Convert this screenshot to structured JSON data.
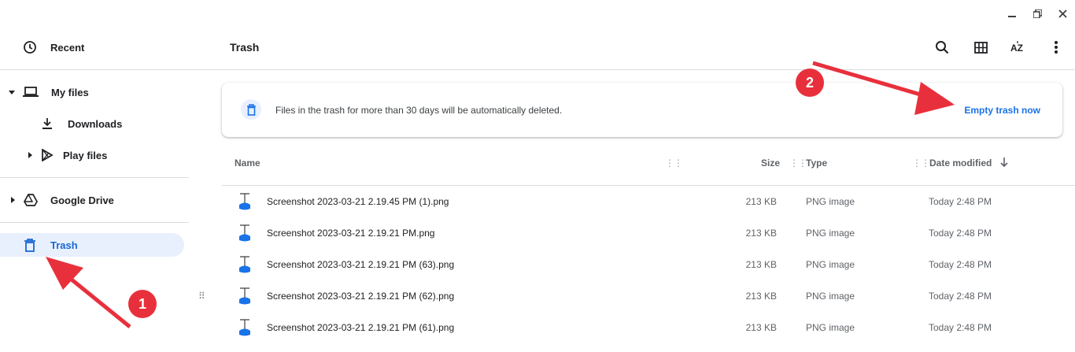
{
  "window": {
    "minimize": "minimize",
    "restore": "restore",
    "close": "close"
  },
  "sidebar": {
    "recent": "Recent",
    "my_files": "My files",
    "downloads": "Downloads",
    "play_files": "Play files",
    "google_drive": "Google Drive",
    "trash": "Trash"
  },
  "header": {
    "title": "Trash"
  },
  "banner": {
    "message": "Files in the trash for more than 30 days will be automatically deleted.",
    "action": "Empty trash now"
  },
  "columns": {
    "name": "Name",
    "size": "Size",
    "type": "Type",
    "date": "Date modified"
  },
  "files": [
    {
      "name": "Screenshot 2023-03-21 2.19.45 PM (1).png",
      "size": "213 KB",
      "type": "PNG image",
      "date": "Today 2:48 PM"
    },
    {
      "name": "Screenshot 2023-03-21 2.19.21 PM.png",
      "size": "213 KB",
      "type": "PNG image",
      "date": "Today 2:48 PM"
    },
    {
      "name": "Screenshot 2023-03-21 2.19.21 PM (63).png",
      "size": "213 KB",
      "type": "PNG image",
      "date": "Today 2:48 PM"
    },
    {
      "name": "Screenshot 2023-03-21 2.19.21 PM (62).png",
      "size": "213 KB",
      "type": "PNG image",
      "date": "Today 2:48 PM"
    },
    {
      "name": "Screenshot 2023-03-21 2.19.21 PM (61).png",
      "size": "213 KB",
      "type": "PNG image",
      "date": "Today 2:48 PM"
    }
  ],
  "annotations": {
    "badge1": "1",
    "badge2": "2"
  },
  "colors": {
    "accent": "#1a73e8",
    "selection": "#e8f0fe",
    "annotation": "#e8303c"
  }
}
